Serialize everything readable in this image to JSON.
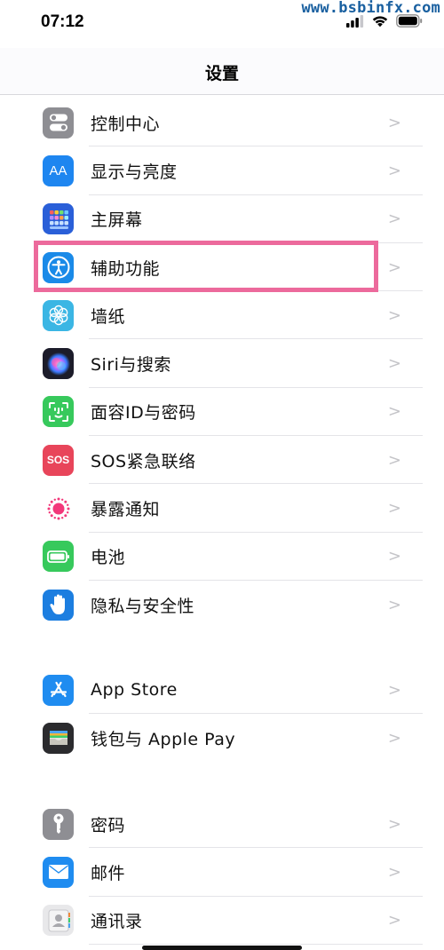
{
  "watermark": "www.bsbinfx.com",
  "status": {
    "time": "07:12"
  },
  "nav": {
    "title": "设置"
  },
  "groups": [
    {
      "items": [
        {
          "label": "控制中心",
          "icon": "control-center-icon",
          "color": "#8e8e93"
        },
        {
          "label": "显示与亮度",
          "icon": "display-brightness-icon",
          "color": "#1e86f0",
          "glyph": "AA"
        },
        {
          "label": "主屏幕",
          "icon": "home-screen-icon",
          "color": "#2a5fd8"
        },
        {
          "label": "辅助功能",
          "icon": "accessibility-icon",
          "color": "#1a8ae8"
        },
        {
          "label": "墙纸",
          "icon": "wallpaper-icon",
          "color": "#3bb6e4"
        },
        {
          "label": "Siri与搜索",
          "icon": "siri-icon",
          "color": "#222233"
        },
        {
          "label": "面容ID与密码",
          "icon": "face-id-icon",
          "color": "#37c95c"
        },
        {
          "label": "SOS紧急联络",
          "icon": "sos-icon",
          "color": "#e8455a",
          "glyph": "SOS"
        },
        {
          "label": "暴露通知",
          "icon": "exposure-notification-icon",
          "color": "#ffffff"
        },
        {
          "label": "电池",
          "icon": "battery-icon",
          "color": "#37c95c"
        },
        {
          "label": "隐私与安全性",
          "icon": "privacy-hand-icon",
          "color": "#1c7ee0"
        }
      ]
    },
    {
      "items": [
        {
          "label": "App Store",
          "icon": "app-store-icon",
          "color": "#1f8cf0"
        },
        {
          "label": "钱包与 Apple Pay",
          "icon": "wallet-icon",
          "color": "#2b2b2e"
        }
      ]
    },
    {
      "items": [
        {
          "label": "密码",
          "icon": "passwords-key-icon",
          "color": "#8e8e93"
        },
        {
          "label": "邮件",
          "icon": "mail-icon",
          "color": "#1f8cf0"
        },
        {
          "label": "通讯录",
          "icon": "contacts-icon",
          "color": "#d9d9dc"
        }
      ]
    }
  ],
  "highlight_color": "#ec6a9c"
}
